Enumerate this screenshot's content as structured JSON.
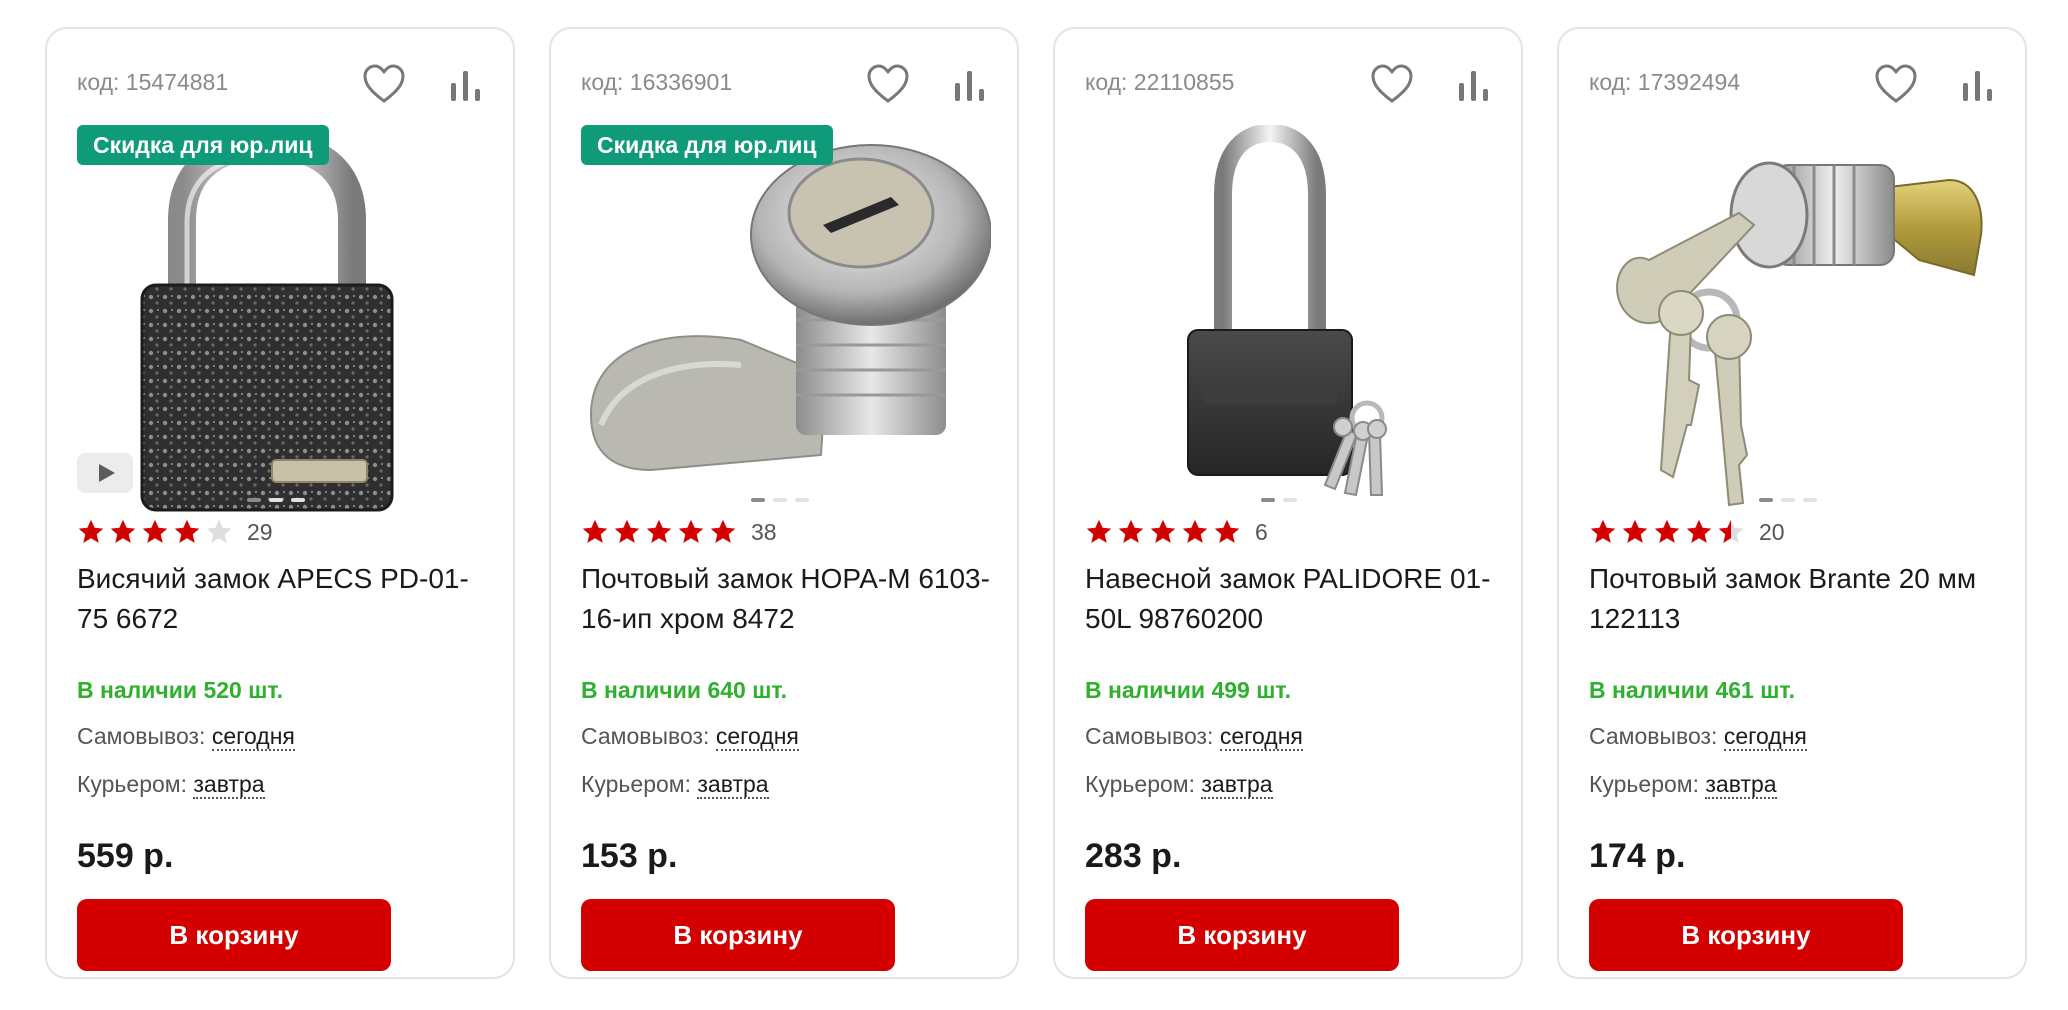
{
  "products": [
    {
      "code": "код: 15474881",
      "badge": "Скидка для юр.лиц",
      "rating": 4,
      "rating_count": "29",
      "title": "Висячий замок APECS PD-01-75 6672",
      "stock": "В наличии 520 шт.",
      "pickup_label": "Самовывоз:",
      "pickup_value": "сегодня",
      "courier_label": "Курьером:",
      "courier_value": "завтра",
      "price": "559 р.",
      "button": "В корзину",
      "image": "padlock-dark-hammered",
      "has_video": true,
      "slides": 3,
      "active_slide": 0
    },
    {
      "code": "код: 16336901",
      "badge": "Скидка для юр.лиц",
      "rating": 5,
      "rating_count": "38",
      "title": "Почтовый замок НОРА-М 6103-16-ип хром 8472",
      "stock": "В наличии 640 шт.",
      "pickup_label": "Самовывоз:",
      "pickup_value": "сегодня",
      "courier_label": "Курьером:",
      "courier_value": "завтра",
      "price": "153 р.",
      "button": "В корзину",
      "image": "cam-lock-chrome",
      "has_video": false,
      "slides": 3,
      "active_slide": 0
    },
    {
      "code": "код: 22110855",
      "badge": "",
      "rating": 5,
      "rating_count": "6",
      "title": "Навесной замок PALIDORE 01-50L 98760200",
      "stock": "В наличии 499 шт.",
      "pickup_label": "Самовывоз:",
      "pickup_value": "сегодня",
      "courier_label": "Курьером:",
      "courier_value": "завтра",
      "price": "283 р.",
      "button": "В корзину",
      "image": "padlock-long-shackle",
      "has_video": false,
      "slides": 2,
      "active_slide": 0
    },
    {
      "code": "код: 17392494",
      "badge": "",
      "rating": 4.5,
      "rating_count": "20",
      "title": "Почтовый замок Brante 20 мм 122113",
      "stock": "В наличии 461 шт.",
      "pickup_label": "Самовывоз:",
      "pickup_value": "сегодня",
      "courier_label": "Курьером:",
      "courier_value": "завтра",
      "price": "174 р.",
      "button": "В корзину",
      "image": "cam-lock-brass-keys",
      "has_video": false,
      "slides": 3,
      "active_slide": 0
    }
  ],
  "icons": {
    "favorite": "heart-icon",
    "compare": "compare-bars-icon",
    "star": "star-icon",
    "play": "play-icon"
  },
  "colors": {
    "accent": "#d40000",
    "badge": "#0f9a7a",
    "stock": "#2fb02f",
    "star": "#d40000"
  }
}
